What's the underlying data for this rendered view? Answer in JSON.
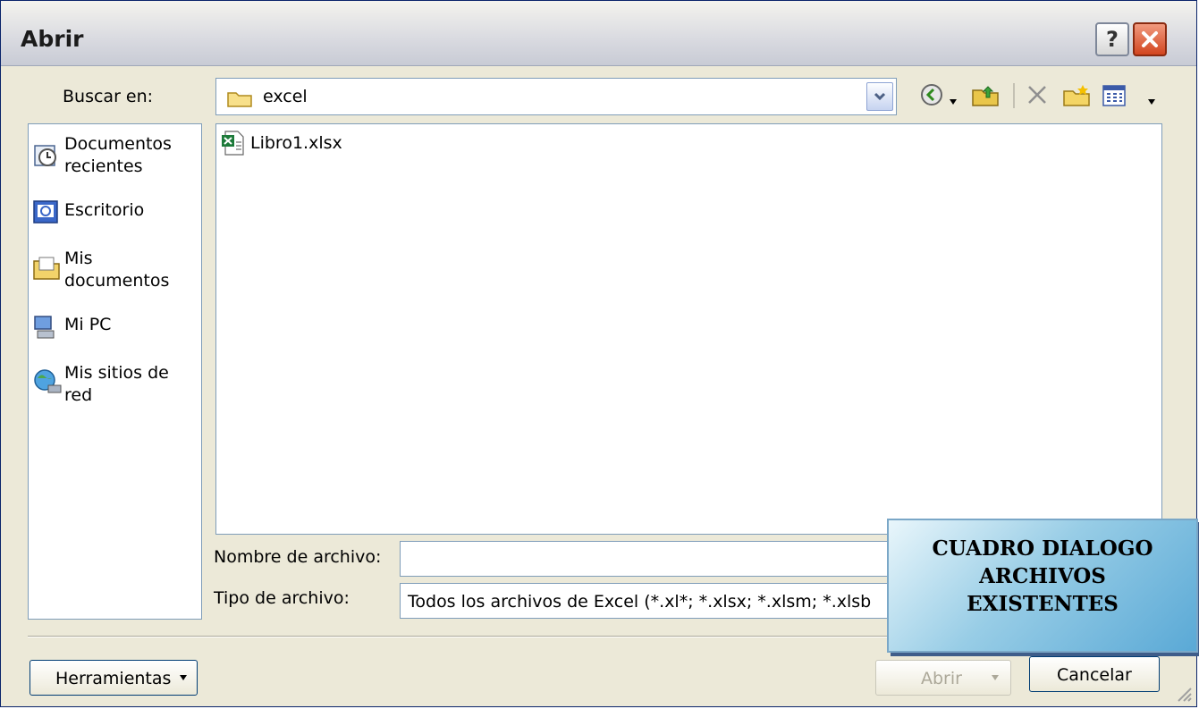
{
  "window": {
    "title": "Abrir"
  },
  "look_in": {
    "label": "Buscar en:",
    "folder": "excel"
  },
  "places": [
    {
      "label": "Documentos recientes",
      "icon": "recent-documents-icon"
    },
    {
      "label": "Escritorio",
      "icon": "desktop-icon"
    },
    {
      "label": "Mis documentos",
      "icon": "my-documents-icon"
    },
    {
      "label": "Mi PC",
      "icon": "my-computer-icon"
    },
    {
      "label": "Mis sitios de red",
      "icon": "network-places-icon"
    }
  ],
  "files": [
    {
      "name": "Libro1.xlsx",
      "icon": "excel-file-icon"
    }
  ],
  "filename": {
    "label": "Nombre de archivo:",
    "value": ""
  },
  "filetype": {
    "label": "Tipo de archivo:",
    "value": "Todos los archivos de Excel (*.xl*; *.xlsx; *.xlsm; *.xlsb"
  },
  "buttons": {
    "tools": "Herramientas",
    "open": "Abrir",
    "cancel": "Cancelar"
  },
  "overlay": {
    "line1": "CUADRO DIALOGO",
    "line2": "ARCHIVOS",
    "line3": "EXISTENTES"
  },
  "colors": {
    "title_bar": "#d9dae0",
    "dialog_bg": "#ece9d8",
    "overlay_blue": "#5aa9d6",
    "close_red": "#d2451f"
  }
}
